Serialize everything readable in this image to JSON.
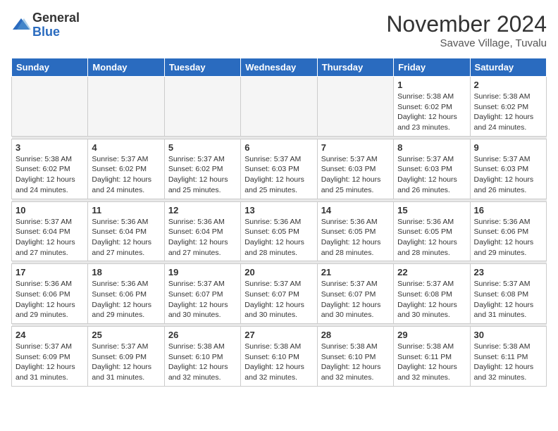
{
  "header": {
    "logo_general": "General",
    "logo_blue": "Blue",
    "month_title": "November 2024",
    "location": "Savave Village, Tuvalu"
  },
  "weekdays": [
    "Sunday",
    "Monday",
    "Tuesday",
    "Wednesday",
    "Thursday",
    "Friday",
    "Saturday"
  ],
  "weeks": [
    [
      {
        "day": "",
        "sunrise": "",
        "sunset": "",
        "daylight": "",
        "empty": true
      },
      {
        "day": "",
        "sunrise": "",
        "sunset": "",
        "daylight": "",
        "empty": true
      },
      {
        "day": "",
        "sunrise": "",
        "sunset": "",
        "daylight": "",
        "empty": true
      },
      {
        "day": "",
        "sunrise": "",
        "sunset": "",
        "daylight": "",
        "empty": true
      },
      {
        "day": "",
        "sunrise": "",
        "sunset": "",
        "daylight": "",
        "empty": true
      },
      {
        "day": "1",
        "sunrise": "Sunrise: 5:38 AM",
        "sunset": "Sunset: 6:02 PM",
        "daylight": "Daylight: 12 hours and 23 minutes.",
        "empty": false
      },
      {
        "day": "2",
        "sunrise": "Sunrise: 5:38 AM",
        "sunset": "Sunset: 6:02 PM",
        "daylight": "Daylight: 12 hours and 24 minutes.",
        "empty": false
      }
    ],
    [
      {
        "day": "3",
        "sunrise": "Sunrise: 5:38 AM",
        "sunset": "Sunset: 6:02 PM",
        "daylight": "Daylight: 12 hours and 24 minutes.",
        "empty": false
      },
      {
        "day": "4",
        "sunrise": "Sunrise: 5:37 AM",
        "sunset": "Sunset: 6:02 PM",
        "daylight": "Daylight: 12 hours and 24 minutes.",
        "empty": false
      },
      {
        "day": "5",
        "sunrise": "Sunrise: 5:37 AM",
        "sunset": "Sunset: 6:02 PM",
        "daylight": "Daylight: 12 hours and 25 minutes.",
        "empty": false
      },
      {
        "day": "6",
        "sunrise": "Sunrise: 5:37 AM",
        "sunset": "Sunset: 6:03 PM",
        "daylight": "Daylight: 12 hours and 25 minutes.",
        "empty": false
      },
      {
        "day": "7",
        "sunrise": "Sunrise: 5:37 AM",
        "sunset": "Sunset: 6:03 PM",
        "daylight": "Daylight: 12 hours and 25 minutes.",
        "empty": false
      },
      {
        "day": "8",
        "sunrise": "Sunrise: 5:37 AM",
        "sunset": "Sunset: 6:03 PM",
        "daylight": "Daylight: 12 hours and 26 minutes.",
        "empty": false
      },
      {
        "day": "9",
        "sunrise": "Sunrise: 5:37 AM",
        "sunset": "Sunset: 6:03 PM",
        "daylight": "Daylight: 12 hours and 26 minutes.",
        "empty": false
      }
    ],
    [
      {
        "day": "10",
        "sunrise": "Sunrise: 5:37 AM",
        "sunset": "Sunset: 6:04 PM",
        "daylight": "Daylight: 12 hours and 27 minutes.",
        "empty": false
      },
      {
        "day": "11",
        "sunrise": "Sunrise: 5:36 AM",
        "sunset": "Sunset: 6:04 PM",
        "daylight": "Daylight: 12 hours and 27 minutes.",
        "empty": false
      },
      {
        "day": "12",
        "sunrise": "Sunrise: 5:36 AM",
        "sunset": "Sunset: 6:04 PM",
        "daylight": "Daylight: 12 hours and 27 minutes.",
        "empty": false
      },
      {
        "day": "13",
        "sunrise": "Sunrise: 5:36 AM",
        "sunset": "Sunset: 6:05 PM",
        "daylight": "Daylight: 12 hours and 28 minutes.",
        "empty": false
      },
      {
        "day": "14",
        "sunrise": "Sunrise: 5:36 AM",
        "sunset": "Sunset: 6:05 PM",
        "daylight": "Daylight: 12 hours and 28 minutes.",
        "empty": false
      },
      {
        "day": "15",
        "sunrise": "Sunrise: 5:36 AM",
        "sunset": "Sunset: 6:05 PM",
        "daylight": "Daylight: 12 hours and 28 minutes.",
        "empty": false
      },
      {
        "day": "16",
        "sunrise": "Sunrise: 5:36 AM",
        "sunset": "Sunset: 6:06 PM",
        "daylight": "Daylight: 12 hours and 29 minutes.",
        "empty": false
      }
    ],
    [
      {
        "day": "17",
        "sunrise": "Sunrise: 5:36 AM",
        "sunset": "Sunset: 6:06 PM",
        "daylight": "Daylight: 12 hours and 29 minutes.",
        "empty": false
      },
      {
        "day": "18",
        "sunrise": "Sunrise: 5:36 AM",
        "sunset": "Sunset: 6:06 PM",
        "daylight": "Daylight: 12 hours and 29 minutes.",
        "empty": false
      },
      {
        "day": "19",
        "sunrise": "Sunrise: 5:37 AM",
        "sunset": "Sunset: 6:07 PM",
        "daylight": "Daylight: 12 hours and 30 minutes.",
        "empty": false
      },
      {
        "day": "20",
        "sunrise": "Sunrise: 5:37 AM",
        "sunset": "Sunset: 6:07 PM",
        "daylight": "Daylight: 12 hours and 30 minutes.",
        "empty": false
      },
      {
        "day": "21",
        "sunrise": "Sunrise: 5:37 AM",
        "sunset": "Sunset: 6:07 PM",
        "daylight": "Daylight: 12 hours and 30 minutes.",
        "empty": false
      },
      {
        "day": "22",
        "sunrise": "Sunrise: 5:37 AM",
        "sunset": "Sunset: 6:08 PM",
        "daylight": "Daylight: 12 hours and 30 minutes.",
        "empty": false
      },
      {
        "day": "23",
        "sunrise": "Sunrise: 5:37 AM",
        "sunset": "Sunset: 6:08 PM",
        "daylight": "Daylight: 12 hours and 31 minutes.",
        "empty": false
      }
    ],
    [
      {
        "day": "24",
        "sunrise": "Sunrise: 5:37 AM",
        "sunset": "Sunset: 6:09 PM",
        "daylight": "Daylight: 12 hours and 31 minutes.",
        "empty": false
      },
      {
        "day": "25",
        "sunrise": "Sunrise: 5:37 AM",
        "sunset": "Sunset: 6:09 PM",
        "daylight": "Daylight: 12 hours and 31 minutes.",
        "empty": false
      },
      {
        "day": "26",
        "sunrise": "Sunrise: 5:38 AM",
        "sunset": "Sunset: 6:10 PM",
        "daylight": "Daylight: 12 hours and 32 minutes.",
        "empty": false
      },
      {
        "day": "27",
        "sunrise": "Sunrise: 5:38 AM",
        "sunset": "Sunset: 6:10 PM",
        "daylight": "Daylight: 12 hours and 32 minutes.",
        "empty": false
      },
      {
        "day": "28",
        "sunrise": "Sunrise: 5:38 AM",
        "sunset": "Sunset: 6:10 PM",
        "daylight": "Daylight: 12 hours and 32 minutes.",
        "empty": false
      },
      {
        "day": "29",
        "sunrise": "Sunrise: 5:38 AM",
        "sunset": "Sunset: 6:11 PM",
        "daylight": "Daylight: 12 hours and 32 minutes.",
        "empty": false
      },
      {
        "day": "30",
        "sunrise": "Sunrise: 5:38 AM",
        "sunset": "Sunset: 6:11 PM",
        "daylight": "Daylight: 12 hours and 32 minutes.",
        "empty": false
      }
    ]
  ]
}
